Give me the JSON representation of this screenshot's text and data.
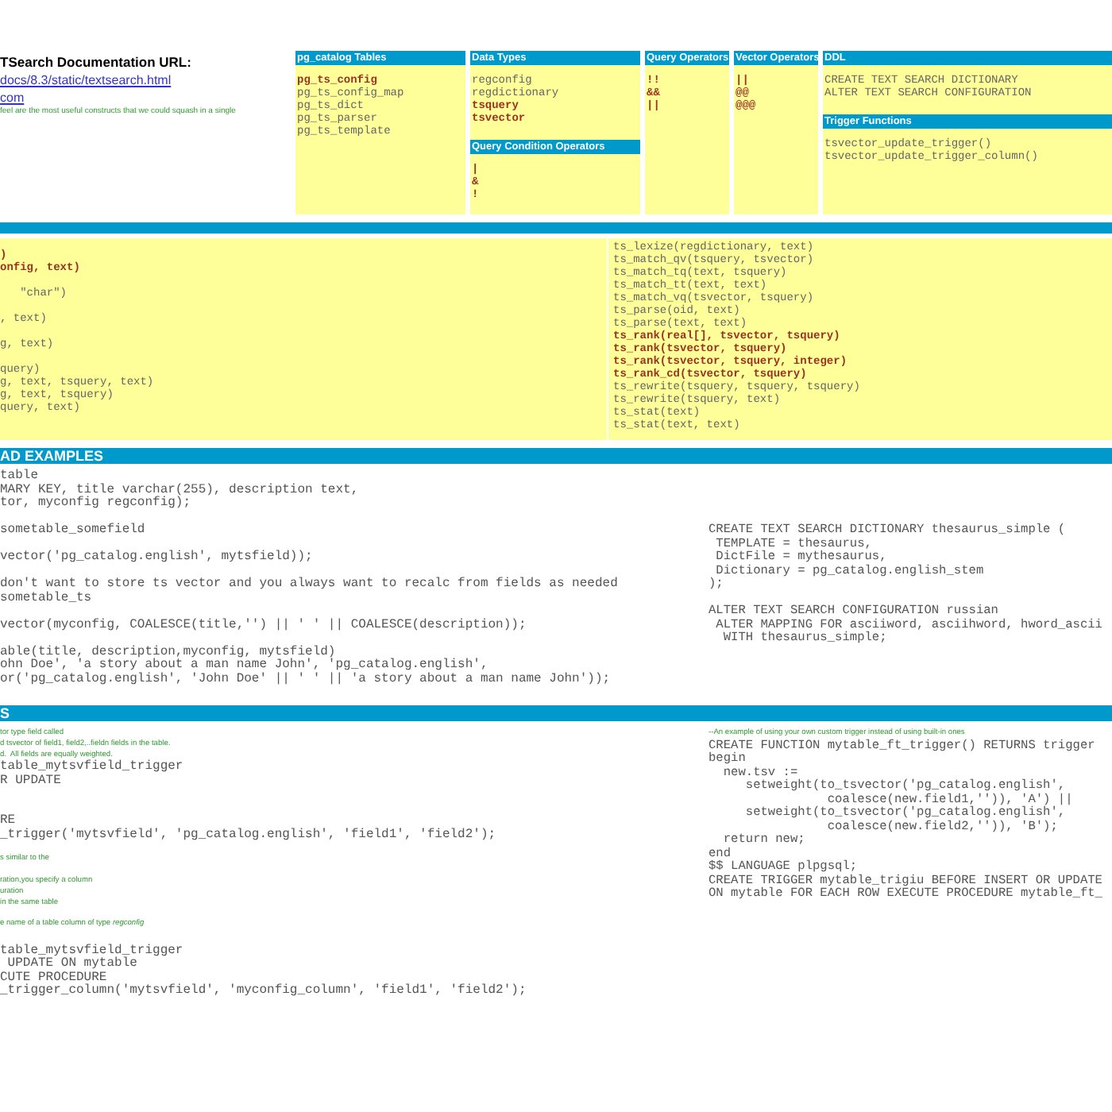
{
  "intro": {
    "title": "TSearch Documentation URL:",
    "links": [
      "docs/8.3/static/textsearch.html",
      "com"
    ],
    "note": "feel are the most useful constructs that we could squash in a single"
  },
  "reference_boxes": [
    {
      "sections": [
        {
          "heading": "pg_catalog Tables",
          "items": [
            {
              "text": "pg_ts_config",
              "bold": true
            },
            {
              "text": "pg_ts_config_map",
              "bold": false
            },
            {
              "text": "pg_ts_dict",
              "bold": false
            },
            {
              "text": "pg_ts_parser",
              "bold": false
            },
            {
              "text": "pg_ts_template",
              "bold": false
            }
          ]
        }
      ]
    },
    {
      "sections": [
        {
          "heading": "Data Types",
          "items": [
            {
              "text": "regconfig",
              "bold": false
            },
            {
              "text": "regdictionary",
              "bold": false
            },
            {
              "text": "tsquery",
              "bold": true
            },
            {
              "text": "tsvector",
              "bold": true
            }
          ]
        },
        {
          "heading": "Query Condition Operators",
          "items": [
            {
              "text": "|",
              "bold": true
            },
            {
              "text": "&",
              "bold": true
            },
            {
              "text": "!",
              "bold": true
            }
          ]
        }
      ]
    },
    {
      "sections": [
        {
          "heading": "Query Operators",
          "items": [
            {
              "text": "!!",
              "bold": true
            },
            {
              "text": "&&",
              "bold": true
            },
            {
              "text": "||",
              "bold": true
            }
          ]
        }
      ]
    },
    {
      "sections": [
        {
          "heading": "Vector Operators",
          "items": [
            {
              "text": "||",
              "bold": true
            },
            {
              "text": "@@",
              "bold": true
            },
            {
              "text": "@@@",
              "bold": true
            }
          ]
        }
      ]
    },
    {
      "sections": [
        {
          "heading": "DDL",
          "items": [
            {
              "text": "CREATE TEXT SEARCH DICTIONARY",
              "bold": false
            },
            {
              "text": "ALTER TEXT SEARCH CONFIGURATION",
              "bold": false
            }
          ]
        },
        {
          "heading": "Trigger Functions",
          "items": [
            {
              "text": "tsvector_update_trigger()",
              "bold": false
            },
            {
              "text": "tsvector_update_trigger_column()",
              "bold": false
            }
          ]
        }
      ]
    }
  ],
  "functions_section": {
    "columns": [
      {
        "groups": [
          {
            "lines": [
              {
                "text": ")",
                "bold": true
              },
              {
                "text": "onfig, text)",
                "bold": true
              }
            ]
          },
          {
            "lines": [
              {
                "text": "   \"char\")",
                "bold": false
              }
            ]
          },
          {
            "lines": [
              {
                "text": ", text)",
                "bold": false
              }
            ]
          },
          {
            "lines": [
              {
                "text": "g, text)",
                "bold": false
              }
            ]
          },
          {
            "lines": [
              {
                "text": "query)",
                "bold": false
              },
              {
                "text": "g, text, tsquery, text)",
                "bold": false
              },
              {
                "text": "g, text, tsquery)",
                "bold": false
              },
              {
                "text": "query, text)",
                "bold": false
              }
            ]
          }
        ]
      },
      {
        "groups": [
          {
            "lines": [
              {
                "text": "ts_lexize(regdictionary, text)",
                "bold": false
              },
              {
                "text": "ts_match_qv(tsquery, tsvector)",
                "bold": false
              },
              {
                "text": "ts_match_tq(text, tsquery)",
                "bold": false
              },
              {
                "text": "ts_match_tt(text, text)",
                "bold": false
              },
              {
                "text": "ts_match_vq(tsvector, tsquery)",
                "bold": false
              },
              {
                "text": "ts_parse(oid, text)",
                "bold": false
              },
              {
                "text": "ts_parse(text, text)",
                "bold": false
              },
              {
                "text": "ts_rank(real[], tsvector, tsquery)",
                "bold": true
              },
              {
                "text": "ts_rank(tsvector, tsquery)",
                "bold": true
              },
              {
                "text": "ts_rank(tsvector, tsquery, integer)",
                "bold": true
              },
              {
                "text": "ts_rank_cd(tsvector, tsquery)",
                "bold": true
              },
              {
                "text": "ts_rewrite(tsquery, tsquery, tsquery)",
                "bold": false
              },
              {
                "text": "ts_rewrite(tsquery, text)",
                "bold": false
              },
              {
                "text": "ts_stat(text)",
                "bold": false
              },
              {
                "text": "ts_stat(text, text)",
                "bold": false
              }
            ]
          }
        ]
      }
    ]
  },
  "examples_section": {
    "heading": "AD EXAMPLES",
    "columns": [
      {
        "blocks": [
          {
            "kind": "code",
            "text": "table\nMARY KEY, title varchar(255), description text,\ntor, myconfig regconfig);"
          },
          {
            "kind": "code",
            "text": "sometable_somefield"
          },
          {
            "kind": "code",
            "text": "vector('pg_catalog.english', mytsfield));"
          },
          {
            "kind": "code",
            "text": "don't want to store ts vector and you always want to recalc from fields as needed\nsometable_ts"
          },
          {
            "kind": "code",
            "text": "vector(myconfig, COALESCE(title,'') || ' ' || COALESCE(description));"
          },
          {
            "kind": "code",
            "text": "able(title, description,myconfig, mytsfield)\nohn Doe', 'a story about a man name John', 'pg_catalog.english',\nor('pg_catalog.english', 'John Doe' || ' ' || 'a story about a man name John'));"
          }
        ]
      },
      {
        "blocks": [
          {
            "kind": "code",
            "text": "CREATE TEXT SEARCH DICTIONARY thesaurus_simple (\n TEMPLATE = thesaurus,\n DictFile = mythesaurus,\n Dictionary = pg_catalog.english_stem\n);"
          },
          {
            "kind": "code",
            "text": "ALTER TEXT SEARCH CONFIGURATION russian\n ALTER MAPPING FOR asciiword, asciihword, hword_ascii\n  WITH thesaurus_simple;"
          }
        ]
      }
    ]
  },
  "triggers_section": {
    "heading": "S",
    "columns": [
      {
        "blocks": [
          {
            "kind": "comment",
            "text": "tor type field called\nd tsvector of field1, field2,..fieldn fields in the table.\nd.  All fields are equally weighted."
          },
          {
            "kind": "code",
            "text": "table_mytsvfield_trigger\nR UPDATE\n\n\nRE\n_trigger('mytsvfield', 'pg_catalog.english', 'field1', 'field2');"
          },
          {
            "kind": "comment",
            "text": "s similar to the\n\nration,you specify a column\nuration\nin the same table\n\ne name of a table column of type *regconfig*"
          },
          {
            "kind": "code",
            "text": "table_mytsvfield_trigger\n UPDATE ON mytable\nCUTE PROCEDURE\n_trigger_column('mytsvfield', 'myconfig_column', 'field1', 'field2');"
          }
        ]
      },
      {
        "blocks": [
          {
            "kind": "comment",
            "text": "--An example of using your own custom trigger instead of using built-in ones"
          },
          {
            "kind": "code",
            "text": "CREATE FUNCTION mytable_ft_trigger() RETURNS trigger\nbegin\n  new.tsv :=\n     setweight(to_tsvector('pg_catalog.english',\n                coalesce(new.field1,'')), 'A') ||\n     setweight(to_tsvector('pg_catalog.english',\n                coalesce(new.field2,'')), 'B');\n  return new;\nend\n$$ LANGUAGE plpgsql;\nCREATE TRIGGER mytable_trigiu BEFORE INSERT OR UPDATE\nON mytable FOR EACH ROW EXECUTE PROCEDURE mytable_ft_"
          }
        ]
      }
    ]
  }
}
